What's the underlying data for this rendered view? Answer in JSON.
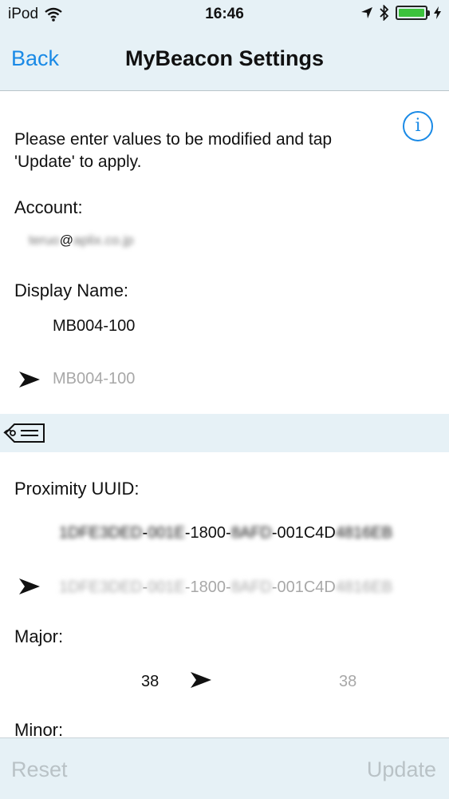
{
  "status_bar": {
    "carrier": "iPod",
    "time": "16:46",
    "battery_level": 1.0,
    "battery_color": "#3cc23c"
  },
  "nav": {
    "back_label": "Back",
    "title": "MyBeacon Settings"
  },
  "info_icon": "i",
  "instructions": "Please enter values to be modified and tap 'Update' to apply.",
  "account": {
    "label": "Account:",
    "value_prefix": "teruo",
    "value_at": "@",
    "value_suffix": "aplix.co.jp"
  },
  "display_name": {
    "label": "Display Name:",
    "current": "MB004-100",
    "new_placeholder": "MB004-100"
  },
  "proximity_uuid": {
    "label": "Proximity UUID:",
    "current_parts": [
      "1DFE3DED",
      "-",
      "001E",
      "-1800-",
      "8AFD",
      "-001C4D",
      "4816EB"
    ],
    "new_parts": [
      "1DFE3DED",
      "-",
      "001E",
      "-1800-",
      "8AFD",
      "-001C4D",
      "4816EB"
    ]
  },
  "major": {
    "label": "Major:",
    "current": "38",
    "new_placeholder": "38"
  },
  "minor": {
    "label": "Minor:"
  },
  "toolbar": {
    "reset_label": "Reset",
    "update_label": "Update"
  },
  "colors": {
    "accent": "#1a8ae6",
    "bar_background": "#e6f1f6",
    "disabled": "#b9c2c6"
  }
}
